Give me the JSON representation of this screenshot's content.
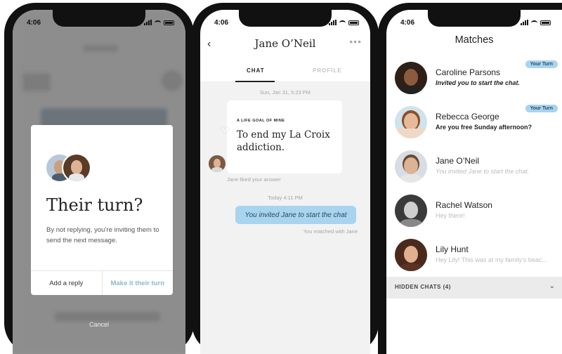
{
  "status": {
    "time": "4:06"
  },
  "screen1": {
    "modal": {
      "title": "Their turn?",
      "body": "By not replying, you’re inviting them to send the next message.",
      "add_reply": "Add a reply",
      "make_their_turn": "Make it their turn"
    },
    "cancel": "Cancel"
  },
  "screen2": {
    "title": "Jane O’Neil",
    "tabs": [
      "CHAT",
      "PROFILE"
    ],
    "timestamp1": "Sun, Jan 31, 5:23 PM",
    "card_label": "A LIFE GOAL OF MINE",
    "card_answer": "To end my La Croix addiction.",
    "liked_note": "Jane liked your answer",
    "timestamp2": "Today 4:11 PM",
    "bubble": "You invited Jane to start the chat",
    "matched_note": "You matched with Jane"
  },
  "screen3": {
    "title": "Matches",
    "rows": [
      {
        "name": "Caroline Parsons",
        "sub": "Invited you to start the chat.",
        "badge": "Your Turn",
        "style": "bold"
      },
      {
        "name": "Rebecca George",
        "sub": "Are you free Sunday afternoon?",
        "badge": "Your Turn",
        "style": "bold-plain"
      },
      {
        "name": "Jane O’Neil",
        "sub": "You invited Jane to start the chat.",
        "badge": "",
        "style": "muted"
      },
      {
        "name": "Rachel Watson",
        "sub": "Hey there!",
        "badge": "",
        "style": "plain"
      },
      {
        "name": "Lily Hunt",
        "sub": "Hey Lily! This was at my family’s beac...",
        "badge": "",
        "style": "plain"
      }
    ],
    "hidden_chats": "HIDDEN CHATS (4)"
  },
  "colors": {
    "accent": "#a8d4ef",
    "accent_text": "#2b4a5f",
    "muted_link": "#8fb7d2"
  }
}
